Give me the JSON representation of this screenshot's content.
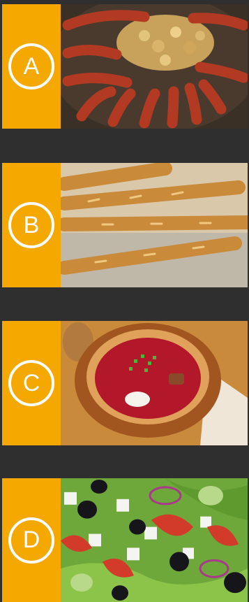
{
  "options": [
    {
      "letter": "A",
      "image_icon": "sausages-potatoes-pan-photo"
    },
    {
      "letter": "B",
      "image_icon": "baguettes-photo"
    },
    {
      "letter": "C",
      "image_icon": "borscht-bowl-photo"
    },
    {
      "letter": "D",
      "image_icon": "greek-salad-photo"
    }
  ],
  "colors": {
    "accent": "#f5a800",
    "separator": "#2f2f2f",
    "circle": "#ffffff"
  }
}
